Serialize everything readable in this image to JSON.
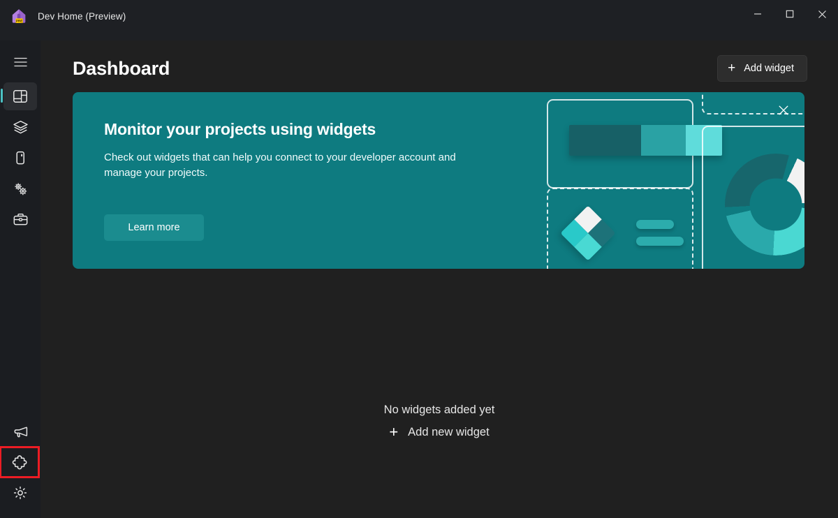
{
  "window": {
    "title": "Dev Home (Preview)",
    "app_icon": "dev-home-icon",
    "controls": {
      "minimize": "Minimize",
      "maximize": "Maximize",
      "close": "Close"
    }
  },
  "sidebar": {
    "top_items": [
      {
        "name": "navigation-menu",
        "icon": "hamburger-icon",
        "label": "Navigation menu",
        "selected": false
      },
      {
        "name": "dashboard",
        "icon": "dashboard-icon",
        "label": "Dashboard",
        "selected": true
      },
      {
        "name": "machine-configuration",
        "icon": "layers-icon",
        "label": "Machine configuration",
        "selected": false
      },
      {
        "name": "environments",
        "icon": "device-icon",
        "label": "Environments",
        "selected": false
      },
      {
        "name": "utilities",
        "icon": "gears-icon",
        "label": "Utilities",
        "selected": false
      },
      {
        "name": "toolbox",
        "icon": "briefcase-icon",
        "label": "Toolbox",
        "selected": false
      }
    ],
    "bottom_items": [
      {
        "name": "feedback",
        "icon": "megaphone-icon",
        "label": "Feedback",
        "selected": false,
        "highlighted": false
      },
      {
        "name": "extensions",
        "icon": "puzzle-piece-icon",
        "label": "Extensions",
        "selected": false,
        "highlighted": true
      },
      {
        "name": "settings",
        "icon": "gear-icon",
        "label": "Settings",
        "selected": false,
        "highlighted": false
      }
    ],
    "highlight_color": "#ec1c24",
    "selection_color": "#4cc2c4"
  },
  "header": {
    "title": "Dashboard",
    "add_widget_label": "Add widget",
    "add_widget_icon": "plus-icon"
  },
  "banner": {
    "title": "Monitor your projects using widgets",
    "subtitle": "Check out widgets that can help you connect to your developer account and manage your projects.",
    "learn_more_label": "Learn more",
    "close_icon": "close-icon",
    "background_color": "#0e7b80",
    "button_color": "#1b8c8f"
  },
  "empty_state": {
    "message": "No widgets added yet",
    "add_label": "Add new widget",
    "add_icon": "plus-icon"
  }
}
